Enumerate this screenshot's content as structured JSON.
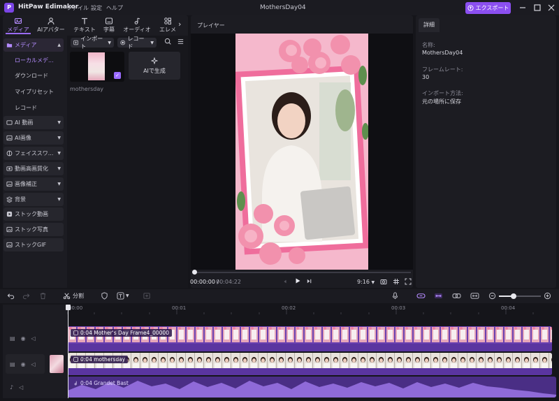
{
  "app": {
    "name": "HitPaw Edimakor",
    "document_title": "MothersDay04"
  },
  "menu": [
    "ファイル",
    "設定",
    "ヘルプ"
  ],
  "export_label": "エクスポート",
  "tool_tabs": [
    {
      "label": "メディア",
      "icon": "media-icon"
    },
    {
      "label": "AIアバター",
      "icon": "ai-avatar-icon"
    },
    {
      "label": "テキスト",
      "icon": "text-icon"
    },
    {
      "label": "字幕",
      "icon": "subtitle-icon"
    },
    {
      "label": "オーディオ",
      "icon": "audio-icon"
    },
    {
      "label": "エレメ",
      "icon": "element-icon"
    }
  ],
  "sidebar": {
    "media_group": "メディア",
    "media_items": [
      "ローカルメデ...",
      "ダウンロード",
      "マイプリセット",
      "レコード"
    ],
    "groups": [
      "AI 動画",
      "AI画像",
      "フェイススワ...",
      "動画高画質化",
      "画像補正",
      "背景"
    ],
    "extras": [
      "ストック動画",
      "ストック写真",
      "ストックGIF"
    ]
  },
  "media_toolbar": {
    "import": "インポート",
    "record": "レコード"
  },
  "media_grid": {
    "thumb_label": "mothersday",
    "ai_generate": "AIで生成"
  },
  "player": {
    "title": "プレイヤー",
    "current_time": "00:00:00",
    "separator": "/",
    "total_time": "00:04:22",
    "aspect_ratio": "9:16",
    "progress": 0
  },
  "details": {
    "tab": "詳細",
    "name_label": "名称:",
    "name_value": "MothersDay04",
    "framerate_label": "フレームレート:",
    "framerate_value": "30",
    "import_label": "インポート方法:",
    "import_value": "元の場所に保存"
  },
  "timeline": {
    "split_label": "分割",
    "ticks": [
      "00:00",
      "00:01",
      "00:02",
      "00:03",
      "00:04"
    ],
    "clips": {
      "frame": "0:04 Mother's Day Frame4_00000",
      "video": "0:04 mothersday",
      "audio": "0:04 Grandet Bast"
    }
  },
  "colors": {
    "accent": "#8b4ff0",
    "clip": "#6a3fb0",
    "audio": "#4a2e85",
    "panel": "#1c1c22"
  }
}
